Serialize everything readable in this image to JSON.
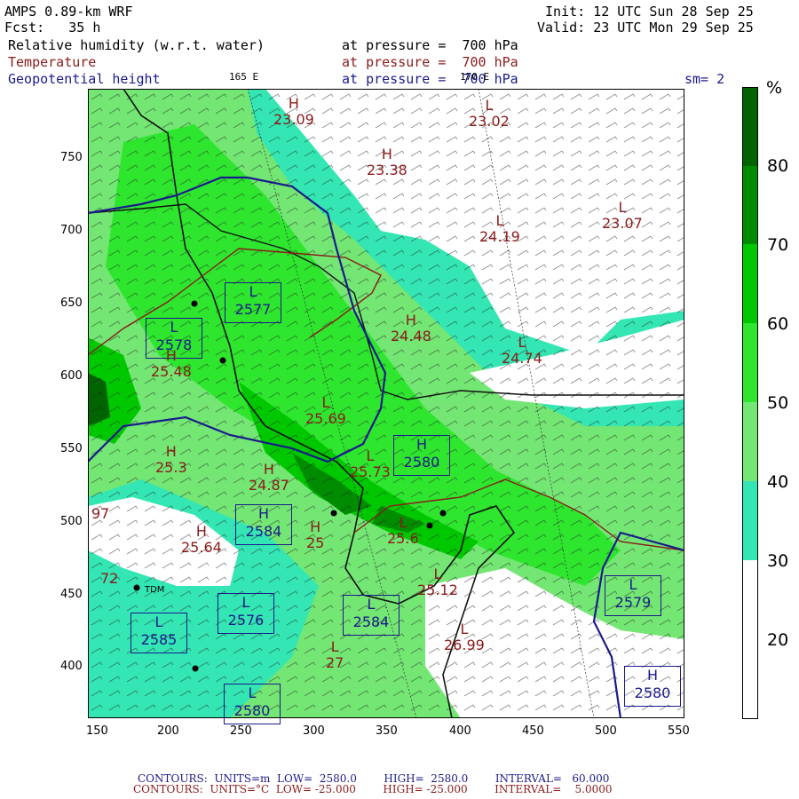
{
  "header": {
    "model": "AMPS 0.89-km WRF",
    "fcst": "Fcst:   35 h",
    "init": "Init: 12 UTC Sun 28 Sep 25",
    "valid": "Valid: 23 UTC Mon 29 Sep 25",
    "fields": [
      {
        "name": "Relative humidity (w.r.t. water)",
        "level": "at pressure =  700 hPa",
        "color": "#000000"
      },
      {
        "name": "Temperature",
        "level": "at pressure =  700 hPa",
        "color": "#8b1a1a"
      },
      {
        "name": "Geopotential height",
        "level": "at pressure =  700 hPa",
        "color": "#1a1a8b"
      }
    ],
    "smoothing": "sm= 2",
    "lon_labels": [
      "165 E",
      "170 E"
    ]
  },
  "axes": {
    "x_ticks": [
      "150",
      "200",
      "250",
      "300",
      "350",
      "400",
      "450",
      "500",
      "550"
    ],
    "y_ticks": [
      "750",
      "700",
      "650",
      "600",
      "550",
      "500",
      "450",
      "400"
    ]
  },
  "colorbar": {
    "unit": "%",
    "labels": [
      "80",
      "70",
      "60",
      "50",
      "40",
      "30",
      "20"
    ],
    "colors": [
      "#006400",
      "#008c00",
      "#00c800",
      "#2ee62e",
      "#73e673",
      "#33e6b3",
      "#ffffff"
    ]
  },
  "station": "TDM",
  "height_labels": [
    {
      "type": "L",
      "value": "2577"
    },
    {
      "type": "L",
      "value": "2578"
    },
    {
      "type": "H",
      "value": "2580"
    },
    {
      "type": "H",
      "value": "2584"
    },
    {
      "type": "L",
      "value": "2576"
    },
    {
      "type": "L",
      "value": "2584"
    },
    {
      "type": "L",
      "value": "2585"
    },
    {
      "type": "L",
      "value": "2579"
    },
    {
      "type": "H",
      "value": "2580"
    },
    {
      "type": "L",
      "value": "2580"
    }
  ],
  "temp_labels": [
    {
      "type": "H",
      "value": "23.09"
    },
    {
      "type": "H",
      "value": "23.38"
    },
    {
      "type": "L",
      "value": "23.02"
    },
    {
      "type": "L",
      "value": "24.19"
    },
    {
      "type": "L",
      "value": "23.07"
    },
    {
      "type": "H",
      "value": "24.48"
    },
    {
      "type": "L",
      "value": "24.74"
    },
    {
      "type": "H",
      "value": "25.48"
    },
    {
      "type": "L",
      "value": "25.69"
    },
    {
      "type": "H",
      "value": "25.3"
    },
    {
      "type": "H",
      "value": "24.87"
    },
    {
      "type": "L",
      "value": "25.73"
    },
    {
      "type": "H",
      "value": "25.64"
    },
    {
      "type": "H",
      "value": "25"
    },
    {
      "type": "L",
      "value": "25.6"
    },
    {
      "type": "L",
      "value": "25.12"
    },
    {
      "type": "L",
      "value": "27"
    },
    {
      "type": "L",
      "value": "26.99"
    },
    {
      "type": "",
      "value": "97"
    },
    {
      "type": "",
      "value": "72"
    }
  ],
  "footer": {
    "line1": "CONTOURS:  UNITS=m  LOW=  2580.0        HIGH=  2580.0        INTERVAL=   60.000",
    "line2": "CONTOURS:  UNITS=°C  LOW= -25.000        HIGH= -25.000        INTERVAL=    5.0000",
    "line1_color": "#1a1a8b",
    "line2_color": "#8b1a1a"
  }
}
